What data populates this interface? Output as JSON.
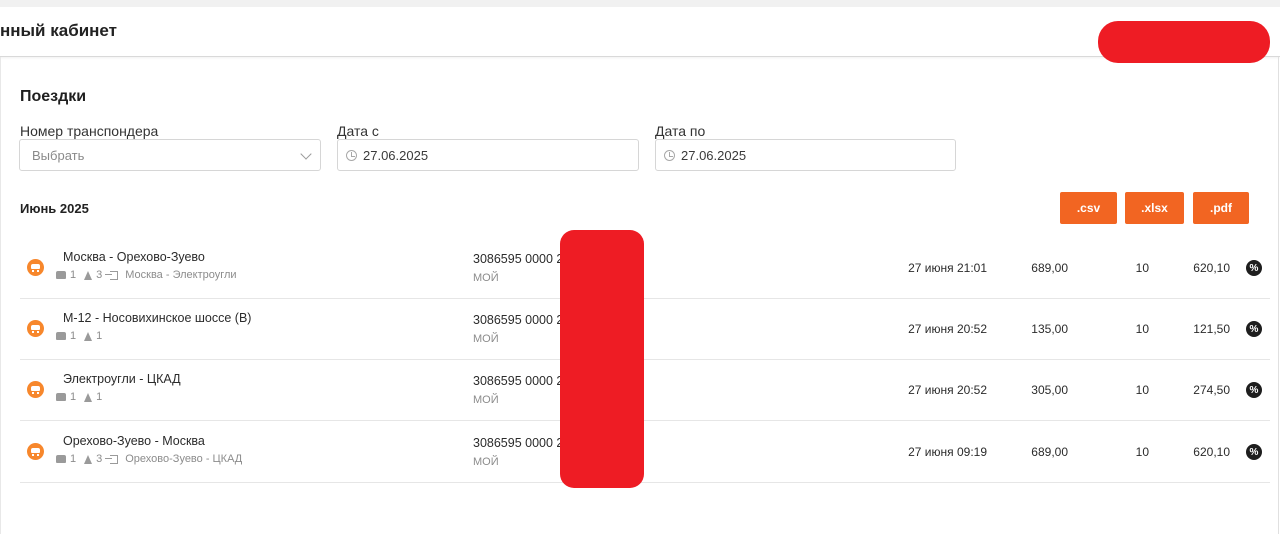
{
  "header": {
    "title": "нный кабинет"
  },
  "page": {
    "title": "Поездки"
  },
  "filters": {
    "transponder": {
      "label": "Номер транспондера",
      "placeholder": "Выбрать"
    },
    "date_from": {
      "label": "Дата с",
      "value": "27.06.2025"
    },
    "date_to": {
      "label": "Дата по",
      "value": "27.06.2025"
    }
  },
  "month": "Июнь 2025",
  "export": {
    "csv": ".csv",
    "xlsx": ".xlsx",
    "pdf": ".pdf"
  },
  "trips": [
    {
      "route": "Москва - Орехово-Зуево",
      "vehicles": "1",
      "sections": "3",
      "subroute": "Москва - Электроугли",
      "card": "3086595 0000 2",
      "card_tag": "МОЙ",
      "date": "27 июня 21:01",
      "price": "689,00",
      "discount": "10",
      "total": "620,10"
    },
    {
      "route": "М-12 - Носовихинское шоссе (В)",
      "vehicles": "1",
      "sections": "1",
      "subroute": "",
      "card": "3086595 0000 2",
      "card_tag": "МОЙ",
      "date": "27 июня 20:52",
      "price": "135,00",
      "discount": "10",
      "total": "121,50"
    },
    {
      "route": "Электроугли - ЦКАД",
      "vehicles": "1",
      "sections": "1",
      "subroute": "",
      "card": "3086595 0000 2",
      "card_tag": "МОЙ",
      "date": "27 июня 20:52",
      "price": "305,00",
      "discount": "10",
      "total": "274,50"
    },
    {
      "route": "Орехово-Зуево - Москва",
      "vehicles": "1",
      "sections": "3",
      "subroute": "Орехово-Зуево - ЦКАД",
      "card": "3086595 0000 2",
      "card_tag": "МОЙ",
      "date": "27 июня 09:19",
      "price": "689,00",
      "discount": "10",
      "total": "620,10"
    }
  ],
  "colors": {
    "accent": "#f26522",
    "icon_orange": "#f7872c",
    "redaction": "#ee1c24"
  }
}
